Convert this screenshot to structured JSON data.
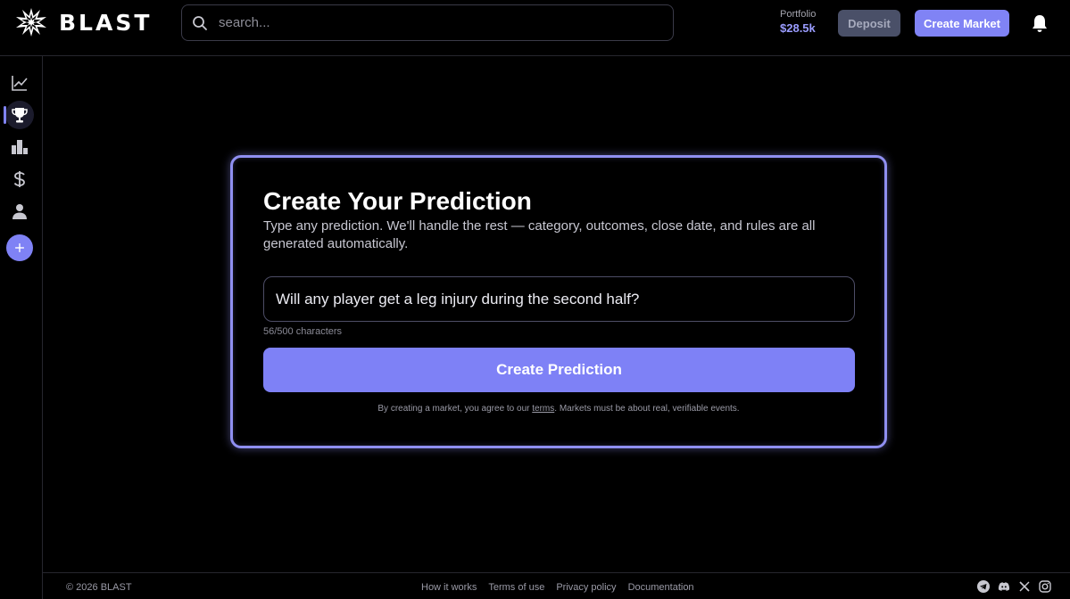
{
  "header": {
    "brand": "BLAST",
    "search_placeholder": "search...",
    "portfolio_label": "Portfolio",
    "portfolio_value": "$28.5k",
    "deposit_label": "Deposit",
    "create_market_label": "Create Market"
  },
  "sidebar": {
    "items": [
      {
        "icon": "chart-icon"
      },
      {
        "icon": "trophy-icon",
        "active": true
      },
      {
        "icon": "leaderboard-icon"
      },
      {
        "icon": "dollar-icon"
      },
      {
        "icon": "user-icon"
      },
      {
        "icon": "plus-icon"
      }
    ]
  },
  "card": {
    "title": "Create Your Prediction",
    "subtitle": "Type any prediction. We'll handle the rest — category, outcomes, close date, and rules are all generated automatically.",
    "input_value": "Will any player get a leg injury during the second half?",
    "char_count": "56/500 characters",
    "button_label": "Create Prediction",
    "terms_before": "By creating a market, you agree to our",
    "terms_link": "terms",
    "terms_after": ". Markets must be about real, verifiable events."
  },
  "footer": {
    "copyright": "© 2026 BLAST",
    "links": [
      "How it works",
      "Terms of use",
      "Privacy policy",
      "Documentation"
    ],
    "social": [
      "telegram-icon",
      "discord-icon",
      "x-icon",
      "instagram-icon"
    ]
  },
  "colors": {
    "accent": "#8083f5",
    "background": "#000000",
    "deposit_bg": "#4a5068"
  }
}
